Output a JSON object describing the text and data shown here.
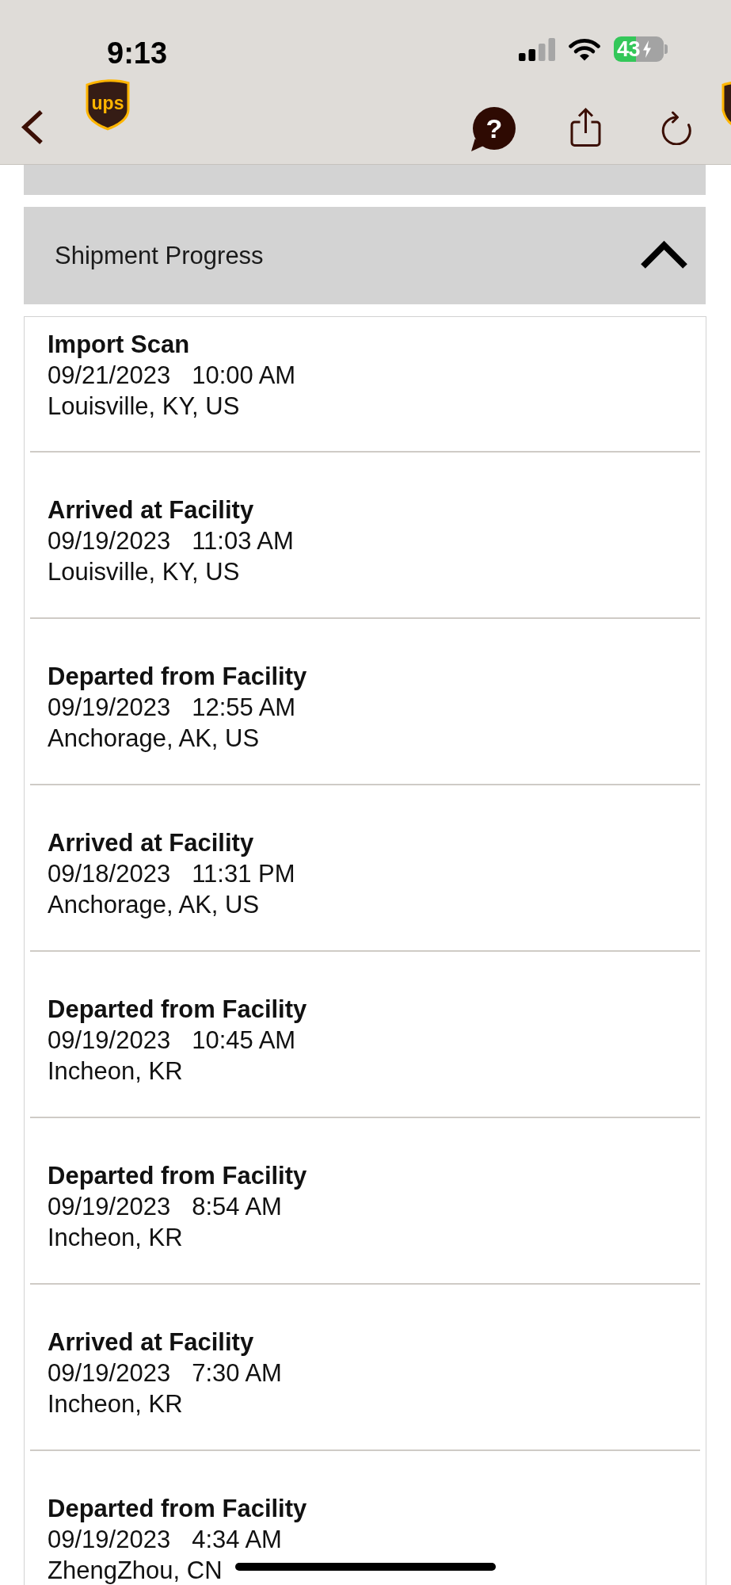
{
  "status_bar": {
    "time": "9:13",
    "battery": "43",
    "charging": true
  },
  "nav": {
    "logo_text": "ups"
  },
  "help_button": {
    "label": "?"
  },
  "section": {
    "title": "Shipment Progress",
    "expanded": true
  },
  "events": [
    {
      "status": "Import Scan",
      "date": "09/21/2023",
      "time": "10:00 AM",
      "location": "Louisville, KY, US"
    },
    {
      "status": "Arrived at Facility",
      "date": "09/19/2023",
      "time": "11:03 AM",
      "location": "Louisville, KY, US"
    },
    {
      "status": "Departed from Facility",
      "date": "09/19/2023",
      "time": "12:55 AM",
      "location": "Anchorage, AK, US"
    },
    {
      "status": "Arrived at Facility",
      "date": "09/18/2023",
      "time": "11:31 PM",
      "location": "Anchorage, AK, US"
    },
    {
      "status": "Departed from Facility",
      "date": "09/19/2023",
      "time": "10:45 AM",
      "location": "Incheon, KR"
    },
    {
      "status": "Departed from Facility",
      "date": "09/19/2023",
      "time": "8:54 AM",
      "location": "Incheon, KR"
    },
    {
      "status": "Arrived at Facility",
      "date": "09/19/2023",
      "time": "7:30 AM",
      "location": "Incheon, KR"
    },
    {
      "status": "Departed from Facility",
      "date": "09/19/2023",
      "time": "4:34 AM",
      "location": "ZhengZhou, CN"
    }
  ]
}
